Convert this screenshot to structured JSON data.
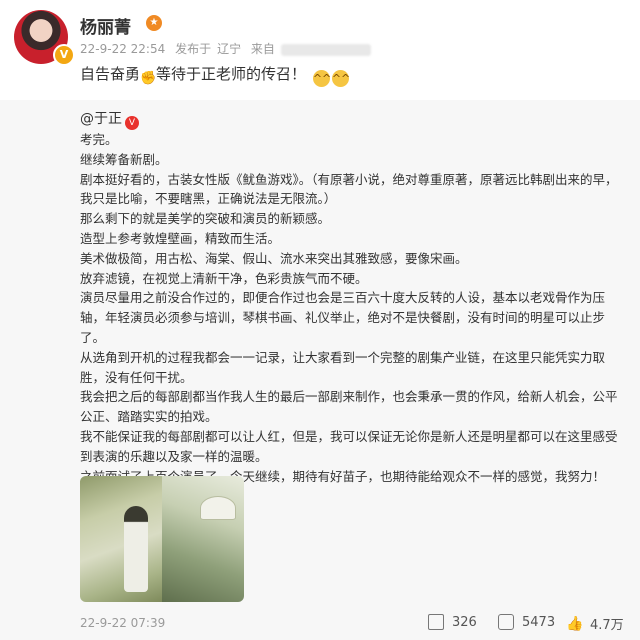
{
  "post": {
    "username": "杨丽菁",
    "timestamp": "22-9-22 22:54",
    "source_prefix": "发布于",
    "location": "辽宁",
    "via_prefix": "来自",
    "text_before": "自告奋勇",
    "text_after": "等待于正老师的传召！"
  },
  "original": {
    "author": "@于正",
    "paragraphs": [
      "考完。",
      "继续筹备新剧。",
      "剧本挺好看的，古装女性版《鱿鱼游戏》。（有原著小说，绝对尊重原著，原著远比韩剧出来的早，我只是比喻，不要瞎黑，正确说法是无限流。）",
      "那么剩下的就是美学的突破和演员的新颖感。",
      "造型上参考敦煌壁画，精致而生活。",
      "美术做极简，用古松、海棠、假山、流水来突出其雅致感，要像宋画。",
      "放弃滤镜，在视觉上清新干净，色彩贵族气而不硬。",
      "演员尽量用之前没合作过的，即便合作过也会是三百六十度大反转的人设，基本以老戏骨作为压轴，年轻演员必须参与培训，琴棋书画、礼仪举止，绝对不是快餐剧，没有时间的明星可以止步了。",
      "从选角到开机的过程我都会一一记录，让大家看到一个完整的剧集产业链，在这里只能凭实力取胜，没有任何干扰。",
      "我会把之后的每部剧都当作我人生的最后一部剧来制作，也会秉承一贯的作风，给新人机会，公平公正、踏踏实实的拍戏。",
      "我不能保证我的每部剧都可以让人红，但是，我可以保证无论你是新人还是明星都可以在这里感受到表演的乐趣以及家一样的温暖。",
      "之前面试了上百个演员了，今天继续，期待有好苗子，也期待能给观众不一样的感觉，我努力！"
    ],
    "timestamp": "22-9-22 07:39",
    "shares": "326",
    "comments": "5473",
    "likes": "4.7万"
  },
  "icons": [
    "vip-badge-icon",
    "muscle-emoji-icon",
    "sweat-smile-emoji-icon",
    "share-icon",
    "comment-icon",
    "like-icon"
  ],
  "colors": {
    "card_bg": "#f7f7f7",
    "meta_gray": "#9a9a9a",
    "badge_orange": "#f3a712",
    "badge_red": "#e9322d"
  }
}
